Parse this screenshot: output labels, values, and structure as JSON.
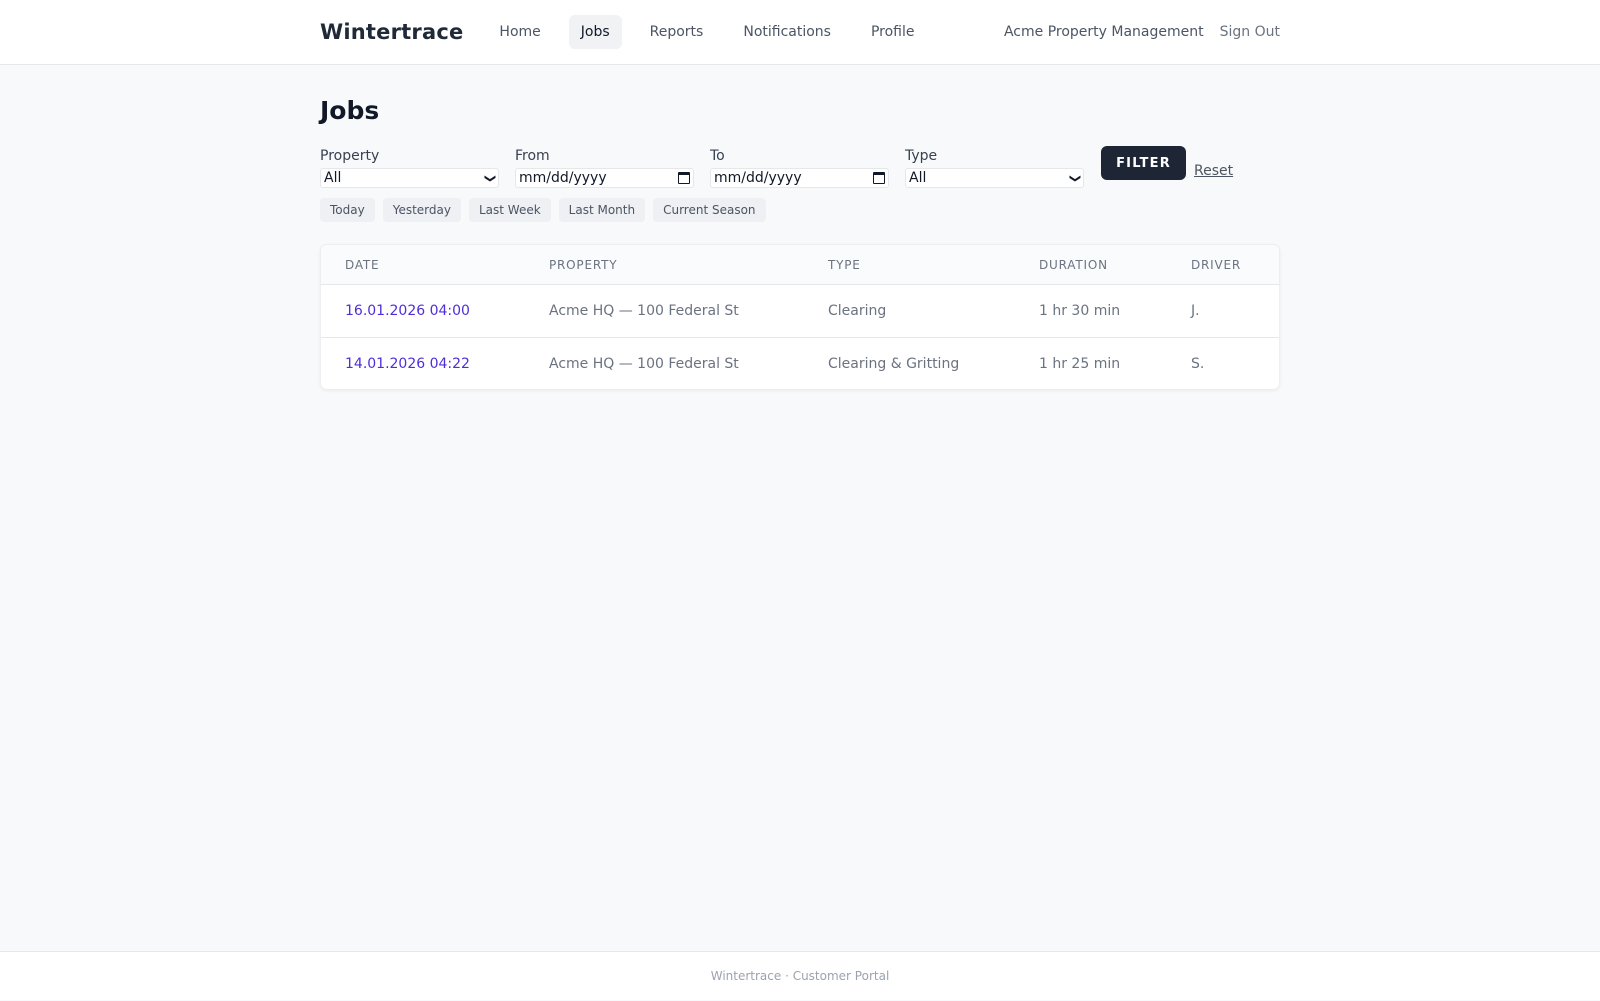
{
  "header": {
    "brand": "Wintertrace",
    "nav": [
      {
        "label": "Home"
      },
      {
        "label": "Jobs",
        "active": true
      },
      {
        "label": "Reports"
      },
      {
        "label": "Notifications"
      },
      {
        "label": "Profile"
      }
    ],
    "org_name": "Acme Property Management",
    "sign_out": "Sign Out"
  },
  "page": {
    "title": "Jobs"
  },
  "filters": {
    "property": {
      "label": "Property",
      "value": "All"
    },
    "from": {
      "label": "From",
      "placeholder": "mm/dd/yyyy"
    },
    "to": {
      "label": "To",
      "placeholder": "mm/dd/yyyy"
    },
    "type": {
      "label": "Type",
      "value": "All"
    },
    "filter_button": "FILTER",
    "reset": "Reset",
    "quick_ranges": [
      "Today",
      "Yesterday",
      "Last Week",
      "Last Month",
      "Current Season"
    ]
  },
  "table": {
    "columns": [
      "DATE",
      "PROPERTY",
      "TYPE",
      "DURATION",
      "DRIVER"
    ],
    "rows": [
      {
        "date": "16.01.2026 04:00",
        "property": "Acme HQ — 100 Federal St",
        "type": "Clearing",
        "duration": "1 hr 30 min",
        "driver": "J."
      },
      {
        "date": "14.01.2026 04:22",
        "property": "Acme HQ — 100 Federal St",
        "type": "Clearing & Gritting",
        "duration": "1 hr 25 min",
        "driver": "S."
      }
    ]
  },
  "footer": {
    "text": "Wintertrace · Customer Portal"
  },
  "colors": {
    "accent": "#1e2636",
    "link": "#4f2dd9",
    "background": "#f8f9fb"
  }
}
